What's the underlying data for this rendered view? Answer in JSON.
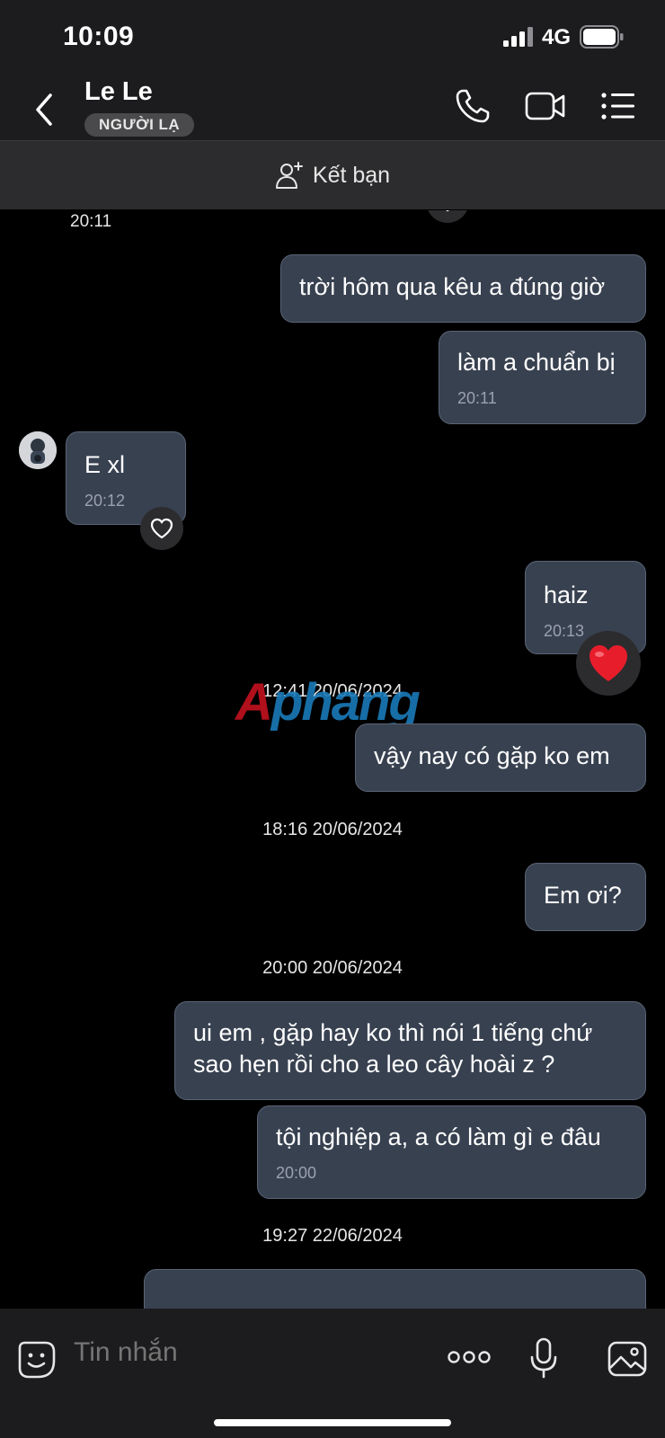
{
  "status_bar": {
    "time": "10:09",
    "network": "4G"
  },
  "header": {
    "contact_name": "Le Le",
    "badge": "NGƯỜI LẠ"
  },
  "add_friend": {
    "label": "Kết bạn"
  },
  "chat": {
    "top_time": "20:11",
    "m1": {
      "text": "trời hôm qua kêu a đúng giờ"
    },
    "m2": {
      "text": "làm a chuẩn bị",
      "time": "20:11"
    },
    "m3": {
      "text": "E xl",
      "time": "20:12"
    },
    "m4": {
      "text": "haiz",
      "time": "20:13"
    },
    "sep1": "12:41 20/06/2024",
    "m5": {
      "text": "vậy nay có gặp ko em"
    },
    "sep2": "18:16 20/06/2024",
    "m6": {
      "text": "Em ơi?"
    },
    "sep3": "20:00 20/06/2024",
    "m7": {
      "line1": "ui em , gặp hay ko thì nói 1 tiếng chứ",
      "line2": "sao hẹn rồi cho a leo cây hoài z ?"
    },
    "m8": {
      "text": "tội nghiệp a, a có làm gì e đâu",
      "time": "20:00"
    },
    "sep4": "19:27 22/06/2024"
  },
  "watermark": {
    "part1": "A",
    "part2": "phang"
  },
  "input": {
    "placeholder": "Tin nhắn"
  },
  "colors": {
    "bubble": "#384150",
    "reaction_heart": "#e81d2c",
    "background": "#000000"
  }
}
